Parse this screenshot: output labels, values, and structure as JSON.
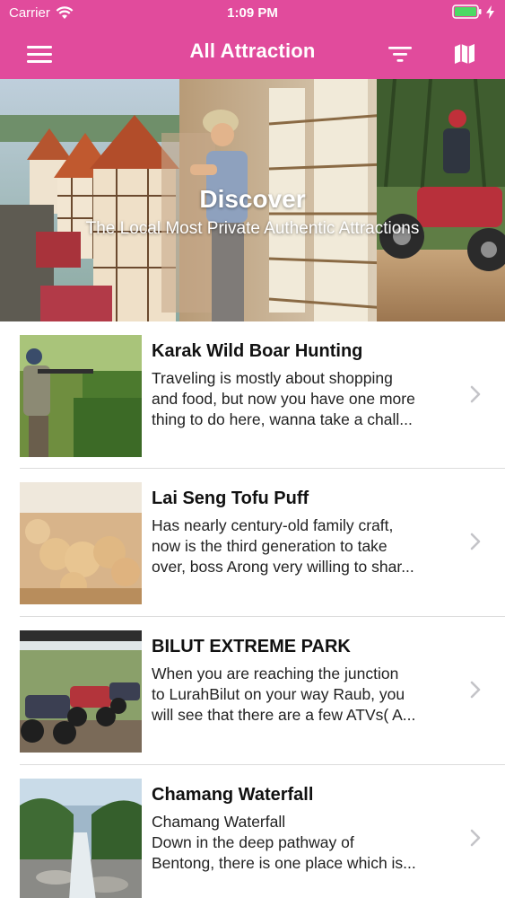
{
  "status_bar": {
    "carrier": "Carrier",
    "time": "1:09 PM",
    "icons": [
      "wifi-icon",
      "battery-icon",
      "charging-bolt-icon"
    ]
  },
  "nav": {
    "title": "All Attraction",
    "left_icon": "hamburger-menu-icon",
    "right_icons": [
      "filter-icon",
      "map-icon"
    ],
    "bar_color": "#e14b9c"
  },
  "hero": {
    "headline": "Discover",
    "subheadline": "The Local Most Private Authentic Attractions"
  },
  "attractions": [
    {
      "title": "Karak Wild Boar Hunting",
      "description": "Traveling is mostly about shopping\nand food, but now you have one more\nthing to do here, wanna take a chall..."
    },
    {
      "title": "Lai Seng Tofu Puff",
      "description": "Has nearly century-old family craft,\nnow is the third generation to take\nover, boss Arong very willing to shar..."
    },
    {
      "title": "BILUT EXTREME PARK",
      "description": "When you are reaching the junction\nto LurahBilut on your way Raub, you\nwill see that there are a few ATVs( A..."
    },
    {
      "title": "Chamang Waterfall",
      "description": "Chamang Waterfall\nDown in the deep pathway of\nBentong, there is one place which is..."
    }
  ]
}
